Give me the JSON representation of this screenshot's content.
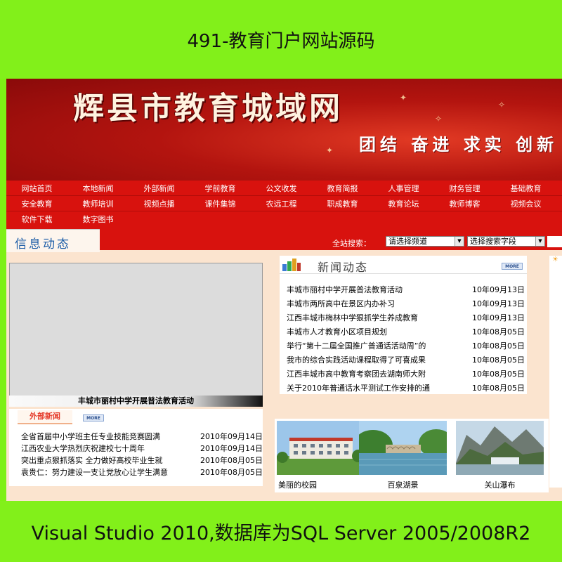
{
  "top_caption": "491-教育门户网站源码",
  "bottom_caption": "Visual Studio 2010,数据库为SQL Server 2005/2008R2",
  "banner": {
    "title": "辉县市教育城域网",
    "slogan": "团结 奋进 求实 创新"
  },
  "nav": {
    "row1": [
      "网站首页",
      "本地新闻",
      "外部新闻",
      "学前教育",
      "公文收发",
      "教育简报",
      "人事管理",
      "财务管理",
      "基础教育"
    ],
    "row2": [
      "安全教育",
      "教师培训",
      "视频点播",
      "课件集锦",
      "农远工程",
      "职成教育",
      "教育论坛",
      "教师博客",
      "视频会议"
    ],
    "row3": [
      "软件下载",
      "数字图书"
    ]
  },
  "info_tab": "信息动态",
  "search": {
    "label": "全站搜索：",
    "channel": "请选择频道",
    "field": "选择搜索字段"
  },
  "photo_caption": "丰城市丽村中学开展普法教育活动",
  "news": {
    "title": "新闻动态",
    "more": "MORE",
    "items": [
      {
        "title": "丰城市丽村中学开展普法教育活动",
        "date": "10年09月13日"
      },
      {
        "title": "丰城市两所高中在景区内办补习",
        "date": "10年09月13日"
      },
      {
        "title": "江西丰城市梅林中学狠抓学生养成教育",
        "date": "10年09月13日"
      },
      {
        "title": "丰城市人才教育小区项目规划",
        "date": "10年08月05日"
      },
      {
        "title": "举行“第十二届全国推广普通话活动周”的",
        "date": "10年08月05日"
      },
      {
        "title": "我市的综合实践活动课程取得了可喜成果",
        "date": "10年08月05日"
      },
      {
        "title": "江西丰城市高中教育考察团去湖南师大附",
        "date": "10年08月05日"
      },
      {
        "title": "关于2010年普通话水平测试工作安排的通",
        "date": "10年08月05日"
      }
    ]
  },
  "external": {
    "title": "外部新闻",
    "more": "MORE",
    "items": [
      {
        "title": "全省首届中小学班主任专业技能竞赛圆满",
        "date": "2010年09月14日"
      },
      {
        "title": "江西农业大学热烈庆祝建校七十周年",
        "date": "2010年09月14日"
      },
      {
        "title": "突出重点狠抓落实  全力做好高校毕业生就",
        "date": "2010年08月05日"
      },
      {
        "title": "袁贵仁：努力建设一支让党放心让学生满意",
        "date": "2010年08月05日"
      }
    ]
  },
  "gallery": [
    {
      "label": "美丽的校园",
      "icon": "campus-photo"
    },
    {
      "label": "百泉湖景",
      "icon": "lake-photo"
    },
    {
      "label": "关山瀑布",
      "icon": "waterfall-photo"
    }
  ]
}
